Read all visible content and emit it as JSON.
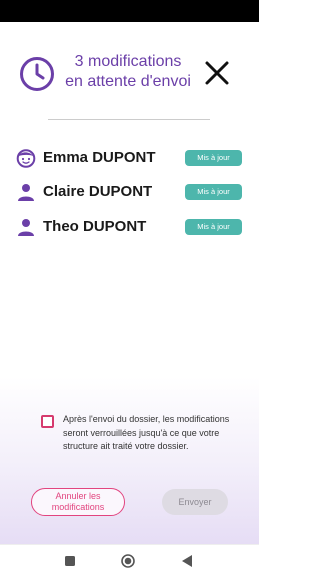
{
  "header": {
    "title_line1": "3 modifications",
    "title_line2": "en attente d'envoi",
    "clock_icon": "clock-icon",
    "close_icon": "close-icon",
    "accent_color": "#6b3fa8"
  },
  "people": [
    {
      "name": "Emma DUPONT",
      "icon": "child-face-icon",
      "status": "Mis à jour"
    },
    {
      "name": "Claire DUPONT",
      "icon": "person-icon",
      "status": "Mis à jour"
    },
    {
      "name": "Theo DUPONT",
      "icon": "person-icon",
      "status": "Mis à jour"
    }
  ],
  "confirmation": {
    "checked": false,
    "text": "Après l'envoi du dossier, les modifications seront verrouillées jusqu'à ce que votre structure ait traité votre dossier."
  },
  "actions": {
    "cancel_label": "Annuler les modifications",
    "send_label": "Envoyer"
  },
  "colors": {
    "badge": "#4db6ac",
    "cancel": "#e2447f",
    "send_disabled": "#dedbe3"
  },
  "nav": {
    "recents_icon": "square-icon",
    "home_icon": "circle-home-icon",
    "back_icon": "triangle-back-icon"
  }
}
